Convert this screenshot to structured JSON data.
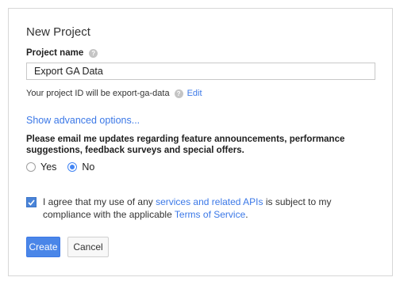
{
  "dialog": {
    "title": "New Project",
    "project_name_label": "Project name",
    "project_name_value": "Export GA Data",
    "project_id_text": "Your project ID will be export-ga-data",
    "edit_link": "Edit",
    "advanced_link": "Show advanced options...",
    "email_question": "Please email me updates regarding feature announcements, performance suggestions, feedback surveys and special offers.",
    "radio_options": [
      {
        "label": "Yes",
        "selected": false
      },
      {
        "label": "No",
        "selected": true
      }
    ],
    "agree": {
      "checked": true,
      "text_before": "I agree that my use of any ",
      "link1": "services and related APIs",
      "text_middle": " is subject to my compliance with the applicable ",
      "link2": "Terms of Service",
      "text_after": "."
    },
    "create_button": "Create",
    "cancel_button": "Cancel"
  },
  "colors": {
    "accent": "#4285f4",
    "link": "#3b78e7",
    "primary_button": "#4a86e8"
  }
}
